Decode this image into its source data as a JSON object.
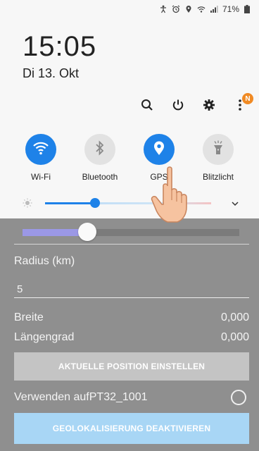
{
  "status_bar": {
    "battery": "71%",
    "icons": [
      "accessibility-icon",
      "alarm-icon",
      "location-icon",
      "wifi-icon",
      "signal-icon",
      "battery-icon"
    ]
  },
  "clock": {
    "time": "15:05",
    "date": "Di 13. Okt"
  },
  "shade_actions": {
    "icons": [
      "search-icon",
      "power-icon",
      "gear-icon",
      "more-icon"
    ],
    "notification_badge": "N"
  },
  "quick_tiles": [
    {
      "label": "Wi-Fi",
      "state": "on",
      "icon": "wifi-icon"
    },
    {
      "label": "Bluetooth",
      "state": "off",
      "icon": "bluetooth-icon"
    },
    {
      "label": "GPS",
      "state": "on",
      "icon": "location-pin-icon"
    },
    {
      "label": "Blitzlicht",
      "state": "off",
      "icon": "flashlight-icon"
    }
  ],
  "brightness": {
    "level": 0.3
  },
  "app": {
    "radius_slider_level": 0.3,
    "radius_label": "Radius (km)",
    "radius_value": "5",
    "latitude_label": "Breite",
    "latitude_value": "0,000",
    "longitude_label": "Längengrad",
    "longitude_value": "0,000",
    "set_position_button": "AKTUELLE POSITION EINSTELLEN",
    "use_on_label": "Verwenden aufPT32_1001",
    "deactivate_button": "GEOLOKALISIERUNG DEAKTIVIEREN"
  },
  "colors": {
    "accent_blue": "#1e82e8",
    "slider_purple": "#9b98e6",
    "badge_orange": "#f08a24",
    "deactivate_button": "#a8d6f5"
  }
}
